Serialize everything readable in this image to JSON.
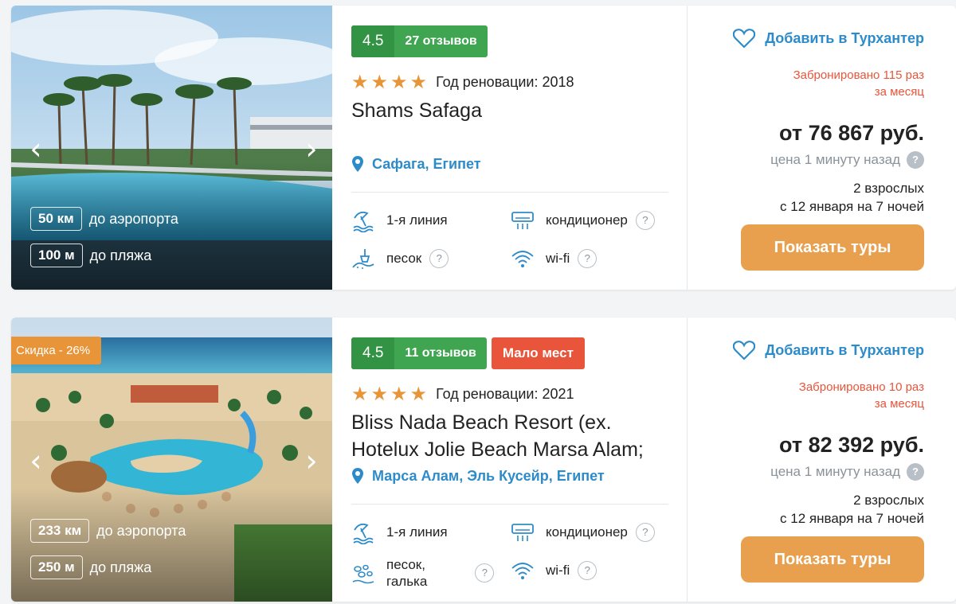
{
  "hotels": [
    {
      "name": "Shams Safaga",
      "rating": "4.5",
      "reviews": "27 отзывов",
      "renovation": "Год реновации: 2018",
      "stars": 4,
      "location": "Сафага, Египет",
      "airport_km": "50 км",
      "airport_label": "до аэропорта",
      "beach_m": "100 м",
      "beach_label": "до пляжа",
      "amenities": {
        "line": "1-я линия",
        "beach": "песок",
        "ac": "кондиционер",
        "wifi": "wi-fi"
      },
      "favorite": "Добавить в Турхантер",
      "booked_line1": "Забронировано 115 раз",
      "booked_line2": "за месяц",
      "price": "от 76 867 руб.",
      "price_ago": "цена 1 минуту назад",
      "pax": "2 взрослых",
      "dates": "с 12 января на 7 ночей",
      "button": "Показать туры"
    },
    {
      "name": "Bliss Nada Beach Resort (ex. Hotelux Jolie Beach Marsa Alam;",
      "rating": "4.5",
      "reviews": "11 отзывов",
      "few_places": "Мало мест",
      "discount": "Скидка - 26%",
      "renovation": "Год реновации: 2021",
      "stars": 4,
      "location": "Марса Алам, Эль Кусейр, Египет",
      "airport_km": "233 км",
      "airport_label": "до аэропорта",
      "beach_m": "250 м",
      "beach_label": "до пляжа",
      "amenities": {
        "line": "1-я линия",
        "beach_1": "песок,",
        "beach_2": "галька",
        "ac": "кондиционер",
        "wifi": "wi-fi"
      },
      "favorite": "Добавить в Турхантер",
      "booked_line1": "Забронировано 10 раз",
      "booked_line2": "за месяц",
      "price": "от 82 392 руб.",
      "price_ago": "цена 1 минуту назад",
      "pax": "2 взрослых",
      "dates": "с 12 января на 7 ночей",
      "button": "Показать туры"
    }
  ],
  "colors": {
    "accent_blue": "#2e8bc9",
    "rating_green": "#3fa551",
    "alert_red": "#e8553a",
    "button_orange": "#e8a04e",
    "star_orange": "#e8953a"
  },
  "icons": {
    "prev": "chevron-left-icon",
    "next": "chevron-right-icon",
    "location": "map-pin-icon",
    "favorite": "heart-icon",
    "line": "beach-umbrella-icon",
    "sand": "sand-shovel-icon",
    "pebble": "pebbles-icon",
    "ac": "air-conditioner-icon",
    "wifi": "wifi-icon",
    "help": "question-icon"
  }
}
